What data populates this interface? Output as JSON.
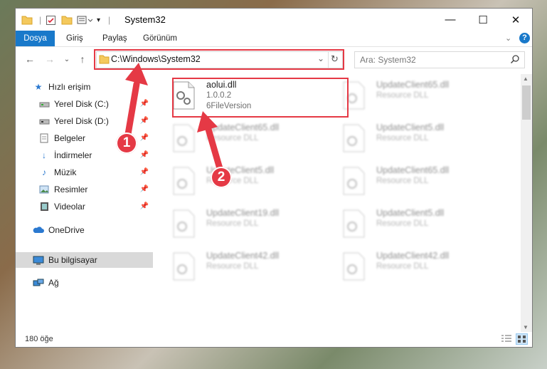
{
  "window": {
    "title": "System32"
  },
  "ribbon": {
    "tabs": [
      "Dosya",
      "Giriş",
      "Paylaş",
      "Görünüm"
    ]
  },
  "address": {
    "path": "C:\\Windows\\System32"
  },
  "search": {
    "placeholder": "Ara: System32"
  },
  "sidebar": {
    "items": [
      {
        "label": "Hızlı erişim"
      },
      {
        "label": "Yerel Disk (C:)"
      },
      {
        "label": "Yerel Disk (D:)"
      },
      {
        "label": "Belgeler"
      },
      {
        "label": "İndirmeler"
      },
      {
        "label": "Müzik"
      },
      {
        "label": "Resimler"
      },
      {
        "label": "Videolar"
      },
      {
        "label": "OneDrive"
      },
      {
        "label": "Bu bilgisayar"
      },
      {
        "label": "Ağ"
      }
    ]
  },
  "files": [
    {
      "name": "aolui.dll",
      "line1": "1.0.0.2",
      "line2": "6FileVersion"
    },
    {
      "name": "UpdateClient65.dll",
      "line1": "Resource DLL"
    },
    {
      "name": "UpdateClient65.dll",
      "line1": "Resource DLL"
    },
    {
      "name": "UpdateClient5.dll",
      "line1": "Resource DLL"
    },
    {
      "name": "UpdateClient5.dll",
      "line1": "Resource DLL"
    },
    {
      "name": "UpdateClient65.dll",
      "line1": "Resource DLL"
    },
    {
      "name": "UpdateClient19.dll",
      "line1": "Resource DLL"
    },
    {
      "name": "UpdateClient5.dll",
      "line1": "Resource DLL"
    },
    {
      "name": "UpdateClient42.dll",
      "line1": "Resource DLL"
    },
    {
      "name": "UpdateClient42.dll",
      "line1": "Resource DLL"
    }
  ],
  "status": {
    "count": "180 öğe"
  },
  "annotations": {
    "step1": "1",
    "step2": "2"
  },
  "colors": {
    "accent": "#1979ca",
    "highlight": "#e53945"
  }
}
